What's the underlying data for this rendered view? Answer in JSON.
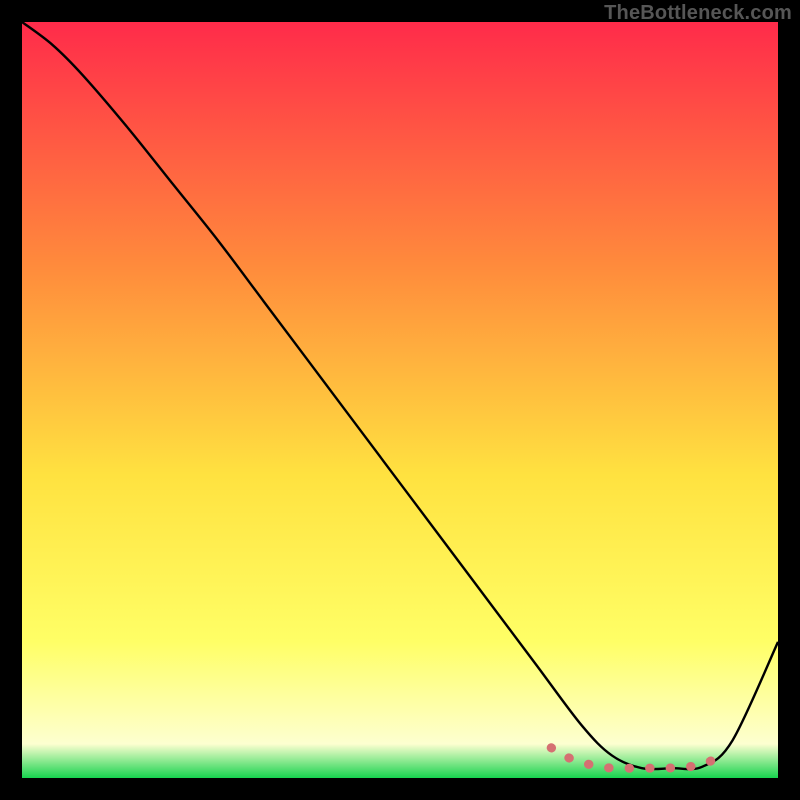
{
  "attribution": "TheBottleneck.com",
  "colors": {
    "frame": "#000000",
    "gradient_top": "#ff2b4a",
    "gradient_mid1": "#ff8a3c",
    "gradient_mid2": "#ffe240",
    "gradient_mid3": "#ffff66",
    "gradient_mid4": "#fdffd0",
    "gradient_bottom": "#17d34f",
    "curve": "#000000",
    "marker": "#d57072"
  },
  "chart_data": {
    "type": "line",
    "title": "",
    "xlabel": "",
    "ylabel": "",
    "xlim": [
      0,
      100
    ],
    "ylim": [
      0,
      100
    ],
    "series": [
      {
        "name": "bottleneck-curve",
        "x": [
          0,
          4,
          8,
          14,
          20,
          26,
          32,
          38,
          44,
          50,
          56,
          62,
          68,
          74,
          78,
          82,
          86,
          90,
          94,
          100
        ],
        "y": [
          100,
          97,
          93,
          86,
          78.5,
          71,
          63,
          55,
          47,
          39,
          31,
          23,
          15,
          7,
          3,
          1.3,
          1.3,
          1.5,
          5,
          18
        ]
      },
      {
        "name": "optimal-band-markers",
        "x": [
          70,
          72,
          75,
          77,
          79,
          81,
          83,
          85,
          87,
          89,
          91,
          92
        ],
        "y": [
          4.0,
          2.8,
          1.8,
          1.4,
          1.3,
          1.3,
          1.3,
          1.3,
          1.4,
          1.6,
          2.2,
          3.0
        ]
      }
    ]
  }
}
